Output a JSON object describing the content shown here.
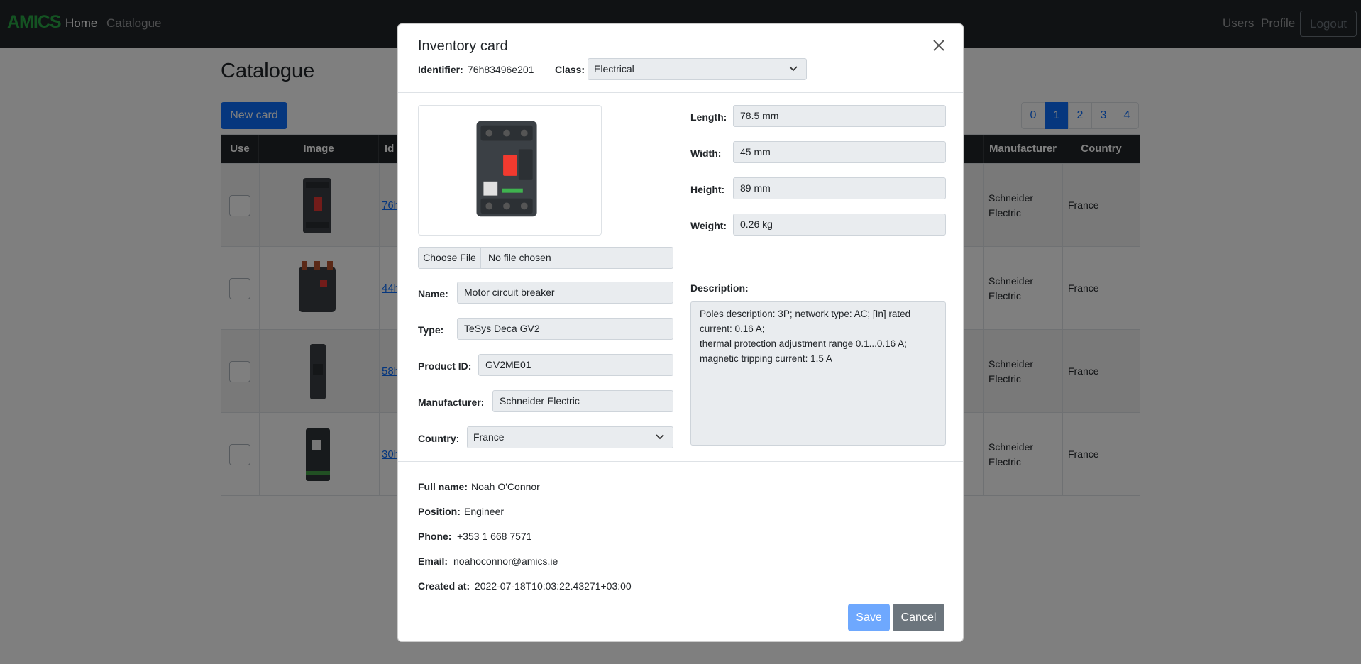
{
  "navbar": {
    "brand": "AMICS",
    "links": [
      "Home",
      "Catalogue"
    ],
    "right_links": [
      "Users",
      "Profile"
    ],
    "logout": "Logout"
  },
  "page": {
    "title": "Catalogue",
    "new_card": "New card",
    "pagination": [
      "0",
      "1",
      "2",
      "3",
      "4"
    ],
    "active_page": "1",
    "table": {
      "headers": [
        "Use",
        "Image",
        "Id",
        "Manufacturer",
        "Country"
      ],
      "rows": [
        {
          "id": "76h",
          "manufacturer": "Schneider Electric",
          "country": "France"
        },
        {
          "id": "44h",
          "manufacturer": "Schneider Electric",
          "country": "France"
        },
        {
          "id": "58h",
          "manufacturer": "Schneider Electric",
          "country": "France"
        },
        {
          "id": "30h",
          "manufacturer": "Schneider Electric",
          "country": "France"
        }
      ]
    }
  },
  "modal": {
    "title": "Inventory card",
    "identifier_label": "Identifier:",
    "identifier_value": "76h83496e201",
    "class_label": "Class:",
    "class_value": "Electrical",
    "file_button": "Choose File",
    "file_text": "No file chosen",
    "fields": {
      "name": {
        "label": "Name:",
        "value": "Motor circuit breaker"
      },
      "type": {
        "label": "Type:",
        "value": "TeSys Deca GV2"
      },
      "product_id": {
        "label": "Product ID:",
        "value": "GV2ME01"
      },
      "manufacturer": {
        "label": "Manufacturer:",
        "value": "Schneider Electric"
      },
      "country": {
        "label": "Country:",
        "value": "France"
      },
      "length": {
        "label": "Length:",
        "value": "78.5 mm"
      },
      "width": {
        "label": "Width:",
        "value": "45 mm"
      },
      "height": {
        "label": "Height:",
        "value": "89 mm"
      },
      "weight": {
        "label": "Weight:",
        "value": "0.26 kg"
      }
    },
    "description_label": "Description:",
    "description_lines": [
      "Poles description: 3P; network type: AC; [In] rated",
      "current: 0.16 A;",
      "thermal protection adjustment range 0.1...0.16 A;",
      "magnetic tripping current: 1.5 A"
    ],
    "info": {
      "full_name": {
        "label": "Full name:",
        "value": "Noah O'Connor"
      },
      "position": {
        "label": "Position:",
        "value": "Engineer"
      },
      "phone": {
        "label": "Phone:",
        "value": "+353 1 668 7571"
      },
      "email": {
        "label": "Email:",
        "value": "noahoconnor@amics.ie"
      },
      "created_at": {
        "label": "Created at:",
        "value": "2022-07-18T10:03:22.43271+03:00"
      }
    },
    "save": "Save",
    "cancel": "Cancel"
  },
  "colors": {
    "primary": "#0d6efd",
    "navbar": "#212529",
    "brand": "#28a745",
    "secondary": "#6c757d"
  }
}
